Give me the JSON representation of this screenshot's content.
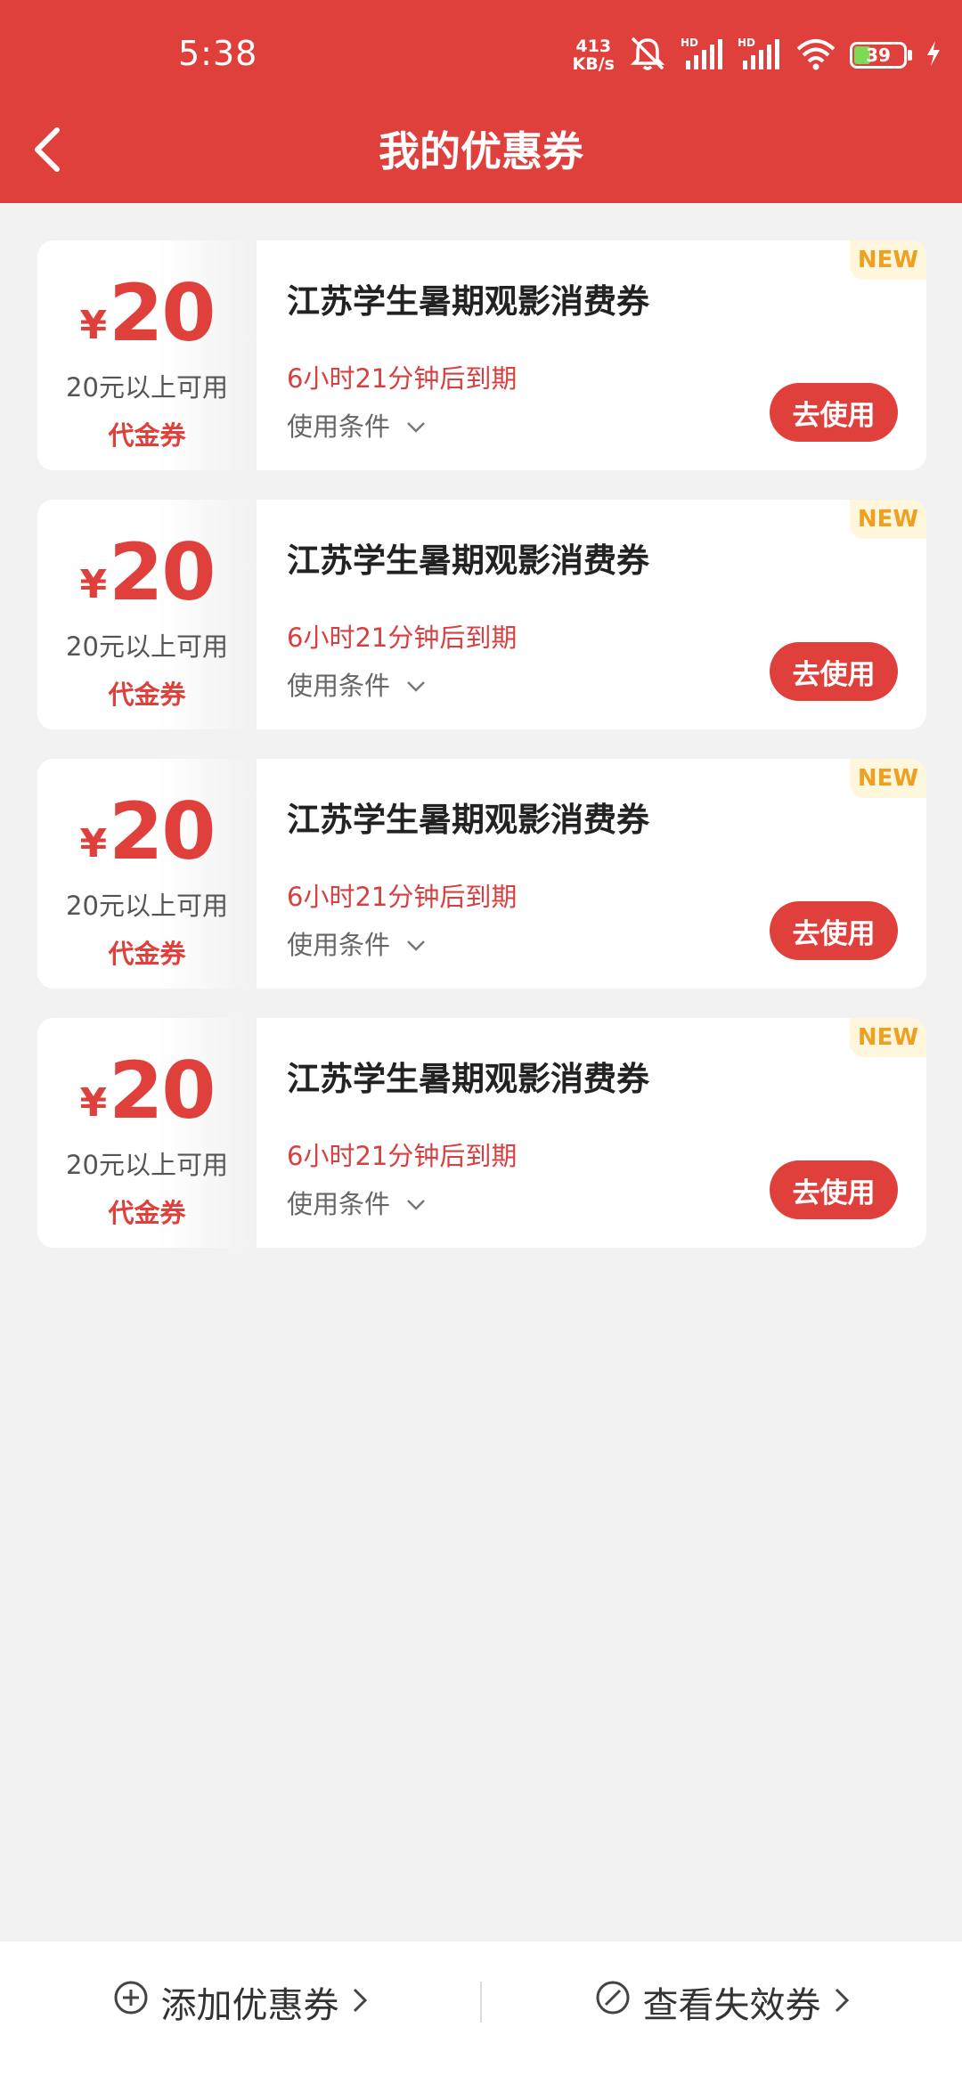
{
  "status_bar": {
    "time": "5:38",
    "net_speed_value": "413",
    "net_speed_unit": "KB/s",
    "battery": "39",
    "icons": [
      "mute-bell-icon",
      "hd-signal-icon",
      "hd-signal-icon",
      "wifi-icon",
      "battery-icon",
      "charging-icon"
    ]
  },
  "header": {
    "title": "我的优惠券",
    "back_icon": "chevron-left-icon"
  },
  "coupons": [
    {
      "currency": "¥",
      "amount": "20",
      "condition": "20元以上可用",
      "type": "代金券",
      "name": "江苏学生暑期观影消费券",
      "expiry": "6小时21分钟后到期",
      "terms_label": "使用条件",
      "use_label": "去使用",
      "badge": "NEW"
    },
    {
      "currency": "¥",
      "amount": "20",
      "condition": "20元以上可用",
      "type": "代金券",
      "name": "江苏学生暑期观影消费券",
      "expiry": "6小时21分钟后到期",
      "terms_label": "使用条件",
      "use_label": "去使用",
      "badge": "NEW"
    },
    {
      "currency": "¥",
      "amount": "20",
      "condition": "20元以上可用",
      "type": "代金券",
      "name": "江苏学生暑期观影消费券",
      "expiry": "6小时21分钟后到期",
      "terms_label": "使用条件",
      "use_label": "去使用",
      "badge": "NEW"
    },
    {
      "currency": "¥",
      "amount": "20",
      "condition": "20元以上可用",
      "type": "代金券",
      "name": "江苏学生暑期观影消费券",
      "expiry": "6小时21分钟后到期",
      "terms_label": "使用条件",
      "use_label": "去使用",
      "badge": "NEW"
    }
  ],
  "bottom_bar": {
    "add_label": "添加优惠券",
    "view_expired_label": "查看失效券"
  },
  "colors": {
    "brand_red": "#e0403c",
    "expiry_red": "#d64040",
    "badge_text": "#f0a020",
    "badge_bg": "#fff6de",
    "page_bg": "#f2f2f2"
  }
}
